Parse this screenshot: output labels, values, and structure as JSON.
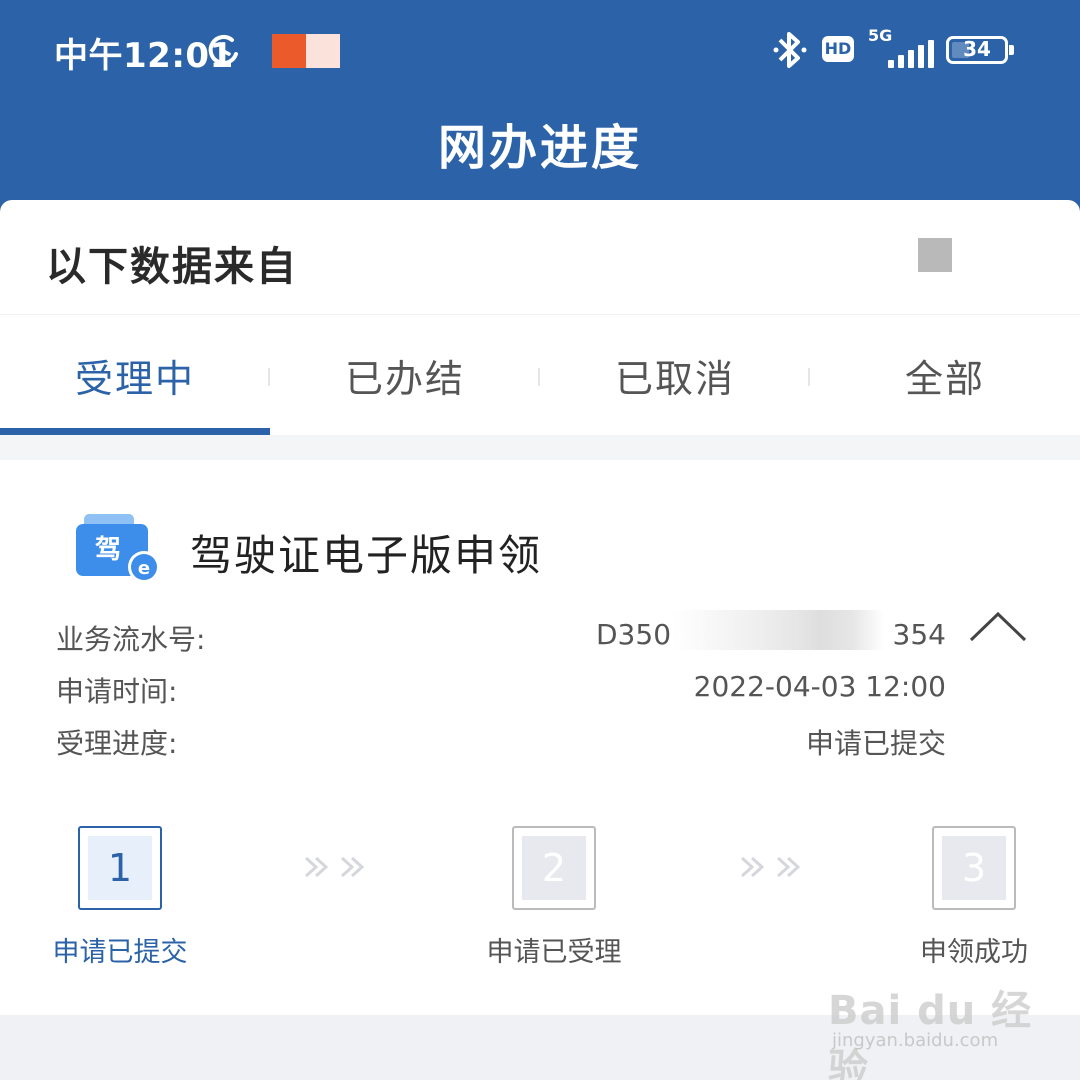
{
  "status_bar": {
    "time": "中午12:01",
    "network": "5G",
    "hd": "HD",
    "battery": "34"
  },
  "header": {
    "title": "网办进度"
  },
  "source": {
    "label": "以下数据来自"
  },
  "tabs": [
    {
      "label": "受理中",
      "active": true
    },
    {
      "label": "已办结",
      "active": false
    },
    {
      "label": "已取消",
      "active": false
    },
    {
      "label": "全部",
      "active": false
    }
  ],
  "application": {
    "icon_char": "驾",
    "title": "驾驶证电子版申领",
    "fields": [
      {
        "label": "业务流水号:",
        "value": "D350C",
        "value_suffix": "354"
      },
      {
        "label": "申请时间:",
        "value": "2022-04-03 12:00"
      },
      {
        "label": "受理进度:",
        "value": "申请已提交"
      }
    ],
    "steps": [
      {
        "number": "1",
        "label": "申请已提交",
        "active": true
      },
      {
        "number": "2",
        "label": "申请已受理",
        "active": false
      },
      {
        "number": "3",
        "label": "申领成功",
        "active": false
      }
    ]
  },
  "watermark": {
    "main": "Bai du 经验",
    "sub": "jingyan.baidu.com"
  },
  "colors": {
    "primary": "#2c63a8",
    "header_bg": "#2c63a8",
    "notif_orange": "#ea5a2b"
  }
}
